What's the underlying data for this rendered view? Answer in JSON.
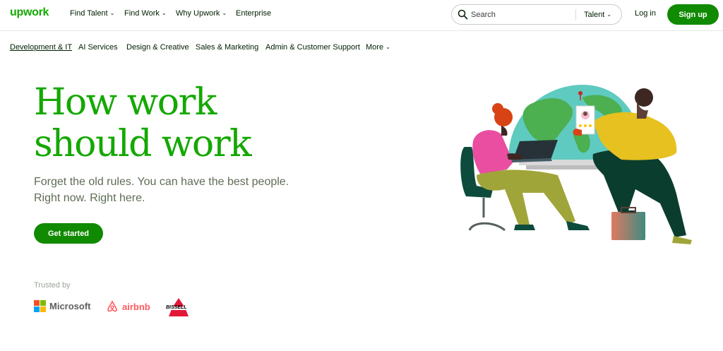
{
  "header": {
    "logo": "upwork",
    "nav": [
      {
        "label": "Find Talent",
        "dropdown": true
      },
      {
        "label": "Find Work",
        "dropdown": true
      },
      {
        "label": "Why Upwork",
        "dropdown": true
      },
      {
        "label": "Enterprise",
        "dropdown": false
      }
    ],
    "search": {
      "placeholder": "Search",
      "category": "Talent"
    },
    "login_label": "Log in",
    "signup_label": "Sign up"
  },
  "categories": [
    {
      "label": "Development & IT",
      "active": true
    },
    {
      "label": "AI Services"
    },
    {
      "label": "Design & Creative"
    },
    {
      "label": "Sales & Marketing"
    },
    {
      "label": "Admin & Customer Support"
    },
    {
      "label": "More",
      "dropdown": true
    }
  ],
  "hero": {
    "title_line1": "How work",
    "title_line2": "should work",
    "subtitle_line1": "Forget the old rules. You can have the best people.",
    "subtitle_line2": "Right now. Right here.",
    "cta_label": "Get started"
  },
  "trusted": {
    "label": "Trusted by",
    "brands": [
      "Microsoft",
      "airbnb",
      "BISSELL"
    ]
  },
  "colors": {
    "brand_green": "#14a800",
    "button_green": "#108a00",
    "airbnb_red": "#ff5a5f",
    "bissell_red": "#e31837"
  },
  "icons": {
    "search": "search-icon",
    "chevron": "chevron-down-icon"
  }
}
